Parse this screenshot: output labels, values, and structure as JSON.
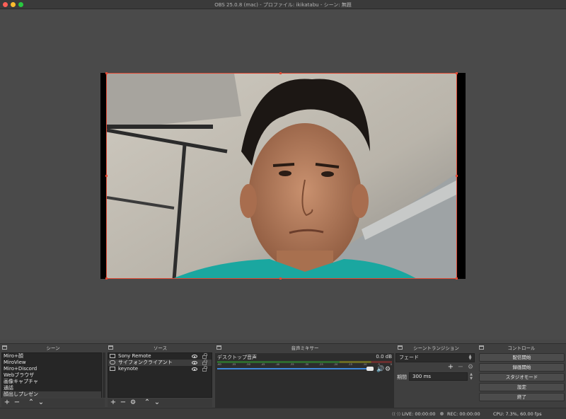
{
  "window": {
    "title": "OBS 25.0.8 (mac) - プロファイル: ikikatabu - シーン: 無題"
  },
  "preview": {
    "image_description_icon": "webcam-person-icon"
  },
  "docks": {
    "scenes": {
      "title": "シーン",
      "items": [
        "Miro+顔",
        "MiroView",
        "Miro+Discord",
        "Webブラウザ",
        "画像キャプチャ",
        "通話",
        "顔出しプレゼン"
      ],
      "selected_index": 6
    },
    "sources": {
      "title": "ソース",
      "items": [
        {
          "label": "Sony Remote",
          "icon": "window-icon"
        },
        {
          "label": "サイフォンクライアント",
          "icon": "link-icon"
        },
        {
          "label": "keynote",
          "icon": "window-icon"
        }
      ],
      "selected_index": 1
    },
    "mixer": {
      "title": "音声ミキサー",
      "track_name": "デスクトップ音声",
      "level": "0.0 dB",
      "volume_fraction": 1.0,
      "ticks": [
        "-60",
        "-55",
        "-50",
        "-45",
        "-40",
        "-35",
        "-30",
        "-25",
        "-20",
        "-15",
        "-10",
        "-5",
        "0"
      ]
    },
    "transitions": {
      "title": "シーントランジション",
      "selected": "フェード",
      "duration_label": "期間",
      "duration_value": "300 ms"
    },
    "controls": {
      "title": "コントロール",
      "buttons": [
        "配信開始",
        "録画開始",
        "スタジオモード",
        "設定",
        "終了"
      ]
    }
  },
  "status": {
    "live": "LIVE: 00:00:00",
    "rec": "REC: 00:00:00",
    "cpu": "CPU: 7.3%, 60.00 fps"
  }
}
